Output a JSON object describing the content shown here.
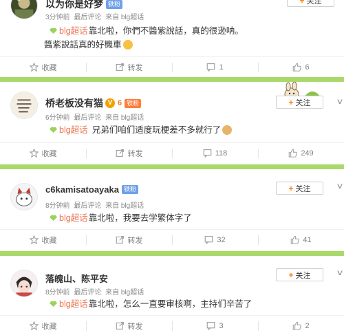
{
  "posts": [
    {
      "username": "以为你是好梦",
      "badges": [
        "铁粉"
      ],
      "meta": {
        "time": "3分钟前",
        "type": "最后评论",
        "source": "来自 blg超话"
      },
      "topic": "blg超话",
      "lines": [
        "靠北啦，你們不醬紫說話，真的很逊呐。",
        "醬紫說話真的好機車"
      ],
      "follow_label": "关注",
      "actions": {
        "favorite": "收藏",
        "forward": "转发",
        "comments": "1",
        "likes": "6"
      }
    },
    {
      "username": "桥老板没有猫",
      "verified": "V",
      "grade_badge": "6",
      "badges": [
        "铁粉"
      ],
      "meta": {
        "time": "6分钟前",
        "type": "最后评论",
        "source": "来自 blg超话"
      },
      "topic": "blg超话",
      "lines": [
        "兄弟们咱们适度玩梗差不多就行了"
      ],
      "follow_label": "关注",
      "actions": {
        "favorite": "收藏",
        "forward": "转发",
        "comments": "118",
        "likes": "249"
      }
    },
    {
      "username": "c6kamisatoayaka",
      "badges": [
        "铁粉"
      ],
      "meta": {
        "time": "8分钟前",
        "type": "最后评论",
        "source": "来自 blg超话"
      },
      "topic": "blg超话",
      "lines": [
        "靠北啦，我要去学繁体字了"
      ],
      "follow_label": "关注",
      "actions": {
        "favorite": "收藏",
        "forward": "转发",
        "comments": "32",
        "likes": "41"
      }
    },
    {
      "username": "落魄山、陈平安",
      "meta": {
        "time": "8分钟前",
        "type": "最后评论",
        "source": "来自 blg超话"
      },
      "topic": "blg超话",
      "lines": [
        "靠北啦，怎么一直要审核啊，主持们辛苦了"
      ],
      "follow_label": "关注",
      "actions": {
        "favorite": "收藏",
        "forward": "转发",
        "comments": "3",
        "likes": "2"
      }
    }
  ],
  "icons": {
    "favorite": "star-icon",
    "forward": "forward-icon",
    "comment": "comment-icon",
    "like": "thumbs-up-icon",
    "topic": "super-topic-diamond-icon",
    "more": "chevron-down-icon"
  },
  "colors": {
    "divider_green": "#a9d96a",
    "topic_text": "#eb7350",
    "follow_plus": "#ff8200",
    "badge_fan": "#6fa0e8"
  }
}
